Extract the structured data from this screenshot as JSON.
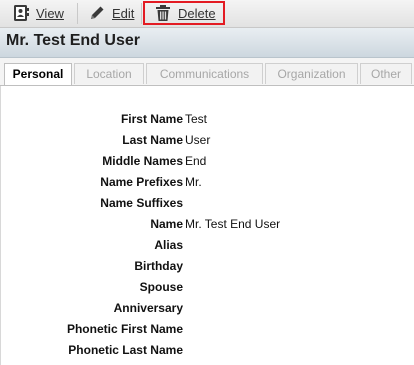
{
  "toolbar": {
    "view_label": "View",
    "edit_label": "Edit",
    "delete_label": "Delete",
    "highlight_color": "#e31b23"
  },
  "title": "Mr. Test End User",
  "tabs": [
    {
      "label": "Personal",
      "active": true
    },
    {
      "label": "Location",
      "active": false
    },
    {
      "label": "Communications",
      "active": false
    },
    {
      "label": "Organization",
      "active": false
    },
    {
      "label": "Other",
      "active": false
    }
  ],
  "fields": [
    {
      "label": "First Name",
      "value": "Test"
    },
    {
      "label": "Last Name",
      "value": "User"
    },
    {
      "label": "Middle Names",
      "value": "End"
    },
    {
      "label": "Name Prefixes",
      "value": "Mr."
    },
    {
      "label": "Name Suffixes",
      "value": ""
    },
    {
      "label": "Name",
      "value": "Mr. Test End User"
    },
    {
      "label": "Alias",
      "value": ""
    },
    {
      "label": "Birthday",
      "value": ""
    },
    {
      "label": "Spouse",
      "value": ""
    },
    {
      "label": "Anniversary",
      "value": ""
    },
    {
      "label": "Phonetic First Name",
      "value": ""
    },
    {
      "label": "Phonetic Last Name",
      "value": ""
    }
  ]
}
